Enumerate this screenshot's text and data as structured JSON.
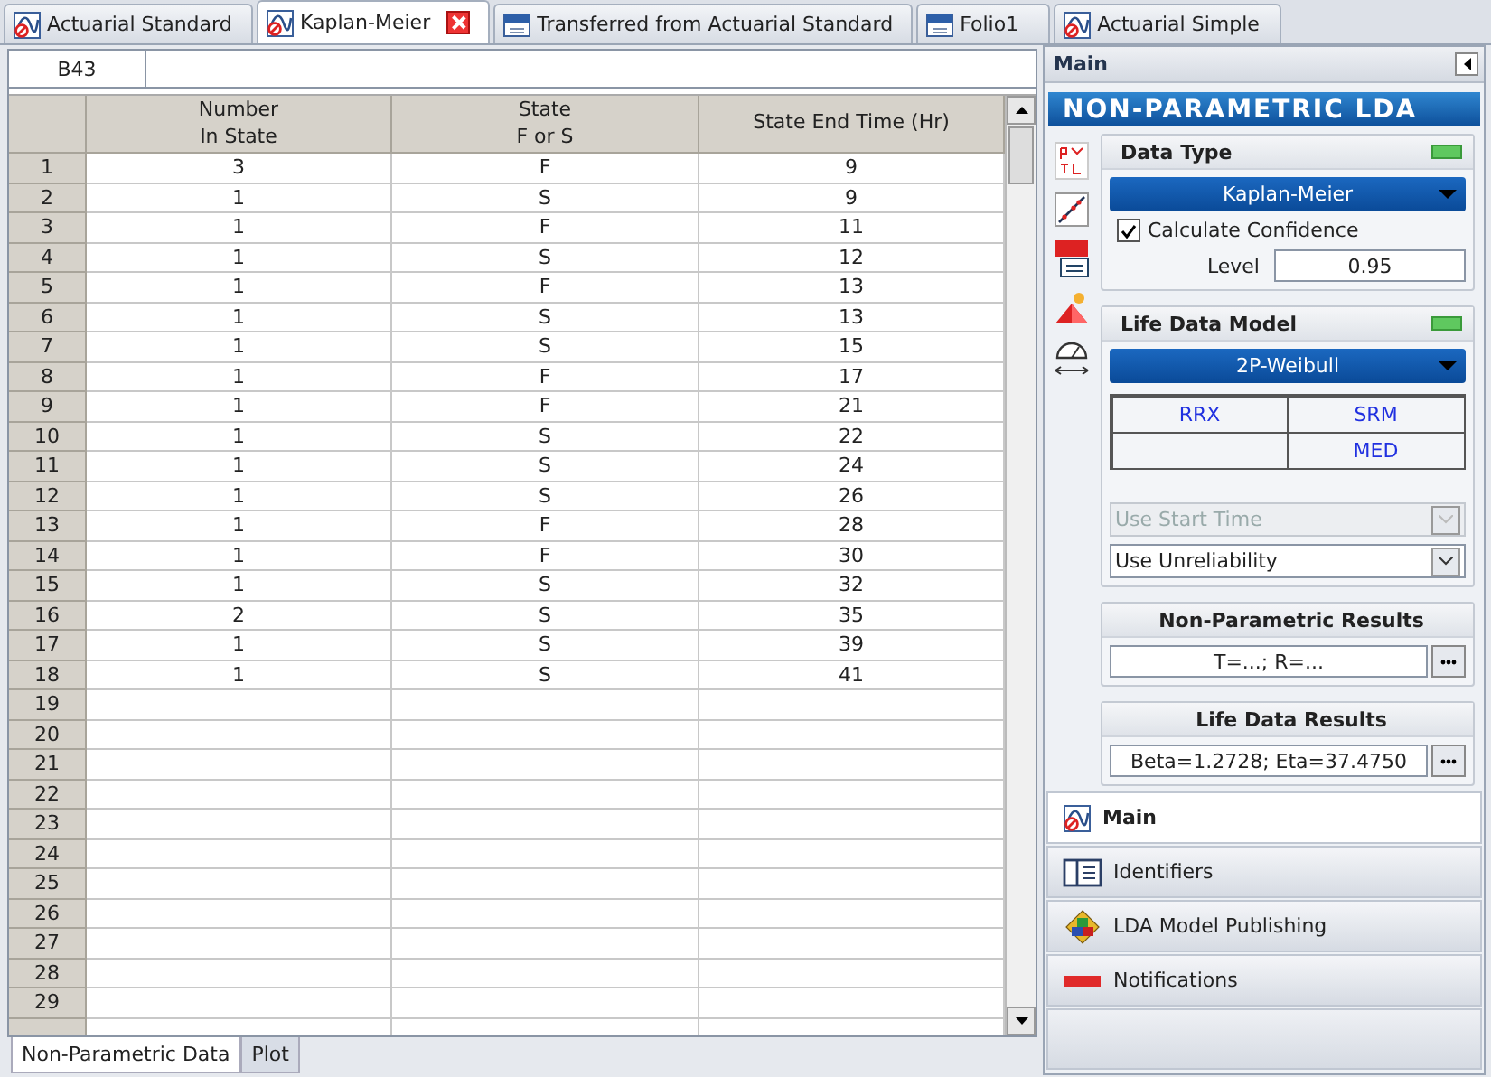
{
  "tabs": [
    {
      "label": "Actuarial Standard",
      "kind": "model",
      "selected": false
    },
    {
      "label": "Kaplan-Meier",
      "kind": "model",
      "selected": true
    },
    {
      "label": "Transferred from Actuarial Standard",
      "kind": "folio",
      "selected": false
    },
    {
      "label": "Folio1",
      "kind": "folio",
      "selected": false
    },
    {
      "label": "Actuarial Simple",
      "kind": "model",
      "selected": false
    }
  ],
  "cell_ref": "B43",
  "sheet": {
    "columns": [
      "Number\nIn State",
      "State\nF or S",
      "State End Time (Hr)"
    ],
    "rows": [
      {
        "number": "1",
        "cells": [
          "3",
          "F",
          "9"
        ]
      },
      {
        "number": "2",
        "cells": [
          "1",
          "S",
          "9"
        ]
      },
      {
        "number": "3",
        "cells": [
          "1",
          "F",
          "11"
        ]
      },
      {
        "number": "4",
        "cells": [
          "1",
          "S",
          "12"
        ]
      },
      {
        "number": "5",
        "cells": [
          "1",
          "F",
          "13"
        ]
      },
      {
        "number": "6",
        "cells": [
          "1",
          "S",
          "13"
        ]
      },
      {
        "number": "7",
        "cells": [
          "1",
          "S",
          "15"
        ]
      },
      {
        "number": "8",
        "cells": [
          "1",
          "F",
          "17"
        ]
      },
      {
        "number": "9",
        "cells": [
          "1",
          "F",
          "21"
        ]
      },
      {
        "number": "10",
        "cells": [
          "1",
          "S",
          "22"
        ]
      },
      {
        "number": "11",
        "cells": [
          "1",
          "S",
          "24"
        ]
      },
      {
        "number": "12",
        "cells": [
          "1",
          "S",
          "26"
        ]
      },
      {
        "number": "13",
        "cells": [
          "1",
          "F",
          "28"
        ]
      },
      {
        "number": "14",
        "cells": [
          "1",
          "F",
          "30"
        ]
      },
      {
        "number": "15",
        "cells": [
          "1",
          "S",
          "32"
        ]
      },
      {
        "number": "16",
        "cells": [
          "2",
          "S",
          "35"
        ]
      },
      {
        "number": "17",
        "cells": [
          "1",
          "S",
          "39"
        ]
      },
      {
        "number": "18",
        "cells": [
          "1",
          "S",
          "41"
        ]
      },
      {
        "number": "19"
      },
      {
        "number": "20"
      },
      {
        "number": "21"
      },
      {
        "number": "22"
      },
      {
        "number": "23"
      },
      {
        "number": "24"
      },
      {
        "number": "25"
      },
      {
        "number": "26"
      },
      {
        "number": "27"
      },
      {
        "number": "28"
      },
      {
        "number": "29"
      }
    ]
  },
  "sheet_tabs": [
    {
      "label": "Non-Parametric Data",
      "selected": true
    },
    {
      "label": "Plot",
      "selected": false
    }
  ],
  "panel": {
    "title": "Main",
    "banner": "NON-PARAMETRIC LDA",
    "data_type": {
      "title": "Data Type",
      "method": "Kaplan-Meier",
      "confidence": {
        "label": "Calculate Confidence",
        "checked": true
      },
      "level_label": "Level",
      "level_value": "0.95"
    },
    "life_data_model": {
      "title": "Life Data Model",
      "distribution": "2P-Weibull",
      "methods": [
        {
          "kind": "option",
          "label": "RRX"
        },
        {
          "kind": "option",
          "label": "SRM"
        },
        {
          "kind": "blank"
        },
        {
          "kind": "option",
          "label": "MED"
        }
      ],
      "options": [
        {
          "label": "Use Start Time",
          "disabled": true
        },
        {
          "label": "Use Unreliability",
          "disabled": false
        }
      ]
    },
    "non_parametric_results": {
      "title": "Non-Parametric Results",
      "value": "T=...; R=..."
    },
    "life_data_results": {
      "title": "Life Data Results",
      "value": "Beta=1.2728; Eta=37.4750"
    }
  },
  "nav": [
    {
      "label": "Main",
      "selected": true
    },
    {
      "label": "Identifiers",
      "selected": false
    },
    {
      "label": "LDA Model Publishing",
      "selected": false
    },
    {
      "label": "Notifications",
      "selected": false
    }
  ]
}
